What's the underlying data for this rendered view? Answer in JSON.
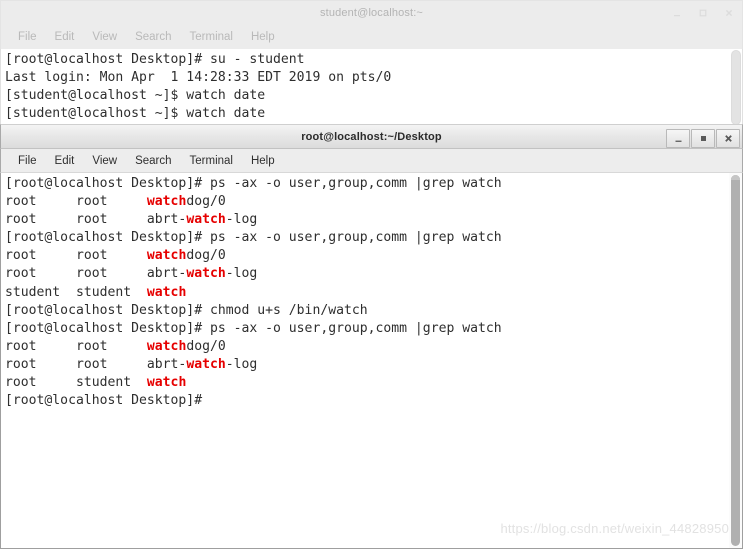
{
  "desktop": {
    "watermark": "https://blog.csdn.net/weixin_44828950"
  },
  "windows": [
    {
      "id": "terminal-student",
      "title": "student@localhost:~",
      "active": false,
      "controls": {
        "minimize_label": "_",
        "maximize_label": "□",
        "close_label": "×"
      },
      "menubar": [
        {
          "label": "File"
        },
        {
          "label": "Edit"
        },
        {
          "label": "View"
        },
        {
          "label": "Search"
        },
        {
          "label": "Terminal"
        },
        {
          "label": "Help"
        }
      ],
      "terminal": {
        "lines": [
          {
            "segments": [
              {
                "text": "[root@localhost Desktop]# su - student",
                "highlight": false
              }
            ]
          },
          {
            "segments": [
              {
                "text": "Last login: Mon Apr  1 14:28:33 EDT 2019 on pts/0",
                "highlight": false
              }
            ]
          },
          {
            "segments": [
              {
                "text": "[student@localhost ~]$ watch date",
                "highlight": false
              }
            ]
          },
          {
            "segments": [
              {
                "text": "[student@localhost ~]$ watch date",
                "highlight": false
              }
            ]
          }
        ],
        "cursor_line": 4,
        "cursor_col": 23
      }
    },
    {
      "id": "terminal-root",
      "title": "root@localhost:~/Desktop",
      "active": true,
      "controls": {
        "minimize_label": "_",
        "maximize_label": "■",
        "close_label": "✕"
      },
      "menubar": [
        {
          "label": "File"
        },
        {
          "label": "Edit"
        },
        {
          "label": "View"
        },
        {
          "label": "Search"
        },
        {
          "label": "Terminal"
        },
        {
          "label": "Help"
        }
      ],
      "terminal": {
        "lines": [
          {
            "segments": [
              {
                "text": "[root@localhost Desktop]# ps -ax -o user,group,comm |grep watch",
                "highlight": false
              }
            ]
          },
          {
            "segments": [
              {
                "text": "root     root     ",
                "highlight": false
              },
              {
                "text": "watch",
                "highlight": true
              },
              {
                "text": "dog/0",
                "highlight": false
              }
            ]
          },
          {
            "segments": [
              {
                "text": "root     root     abrt-",
                "highlight": false
              },
              {
                "text": "watch",
                "highlight": true
              },
              {
                "text": "-log",
                "highlight": false
              }
            ]
          },
          {
            "segments": [
              {
                "text": "[root@localhost Desktop]# ps -ax -o user,group,comm |grep watch",
                "highlight": false
              }
            ]
          },
          {
            "segments": [
              {
                "text": "root     root     ",
                "highlight": false
              },
              {
                "text": "watch",
                "highlight": true
              },
              {
                "text": "dog/0",
                "highlight": false
              }
            ]
          },
          {
            "segments": [
              {
                "text": "root     root     abrt-",
                "highlight": false
              },
              {
                "text": "watch",
                "highlight": true
              },
              {
                "text": "-log",
                "highlight": false
              }
            ]
          },
          {
            "segments": [
              {
                "text": "student  student  ",
                "highlight": false
              },
              {
                "text": "watch",
                "highlight": true
              }
            ]
          },
          {
            "segments": [
              {
                "text": "[root@localhost Desktop]# chmod u+s /bin/watch",
                "highlight": false
              }
            ]
          },
          {
            "segments": [
              {
                "text": "[root@localhost Desktop]# ps -ax -o user,group,comm |grep watch",
                "highlight": false
              }
            ]
          },
          {
            "segments": [
              {
                "text": "root     root     ",
                "highlight": false
              },
              {
                "text": "watch",
                "highlight": true
              },
              {
                "text": "dog/0",
                "highlight": false
              }
            ]
          },
          {
            "segments": [
              {
                "text": "root     root     abrt-",
                "highlight": false
              },
              {
                "text": "watch",
                "highlight": true
              },
              {
                "text": "-log",
                "highlight": false
              }
            ]
          },
          {
            "segments": [
              {
                "text": "root     student  ",
                "highlight": false
              },
              {
                "text": "watch",
                "highlight": true
              }
            ]
          },
          {
            "segments": [
              {
                "text": "[root@localhost Desktop]#",
                "highlight": false
              }
            ]
          }
        ]
      },
      "colors": {
        "grep_highlight": "#e60000"
      }
    }
  ]
}
